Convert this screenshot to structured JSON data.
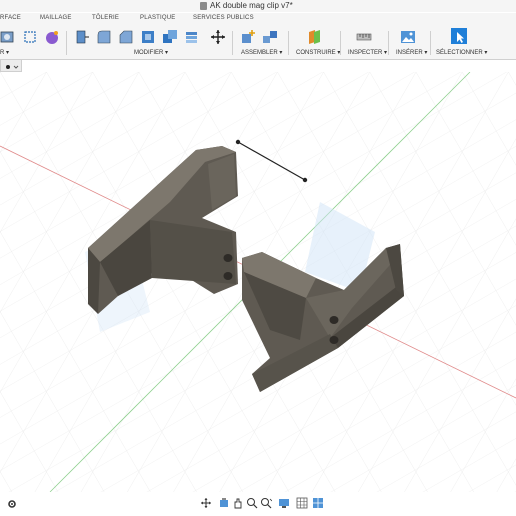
{
  "window": {
    "title": "AK double mag clip v7*"
  },
  "tabs": [
    "RFACE",
    "MAILLAGE",
    "TÔLERIE",
    "PLASTIQUE",
    "SERVICES PUBLICS"
  ],
  "toolbar": {
    "groups": [
      {
        "label": "R ▾"
      },
      {
        "label": "MODIFIER ▾"
      },
      {
        "label": "ASSEMBLER ▾"
      },
      {
        "label": "CONSTRUIRE ▾"
      },
      {
        "label": "INSPECTER ▾"
      },
      {
        "label": "INSÉRER ▾"
      },
      {
        "label": "SÉLECTIONNER ▾"
      }
    ]
  },
  "colors": {
    "toolbar_bg": "#f5f5f5",
    "grid": "#e4e4e4",
    "x_axis": "#e07a7a",
    "y_axis": "#7ec87e",
    "model": "#5a5650",
    "accent": "#1f7fd8"
  },
  "icons": {
    "canvas": [
      "model-clip-left",
      "model-clip-right",
      "sketch-line",
      "axis-lines",
      "grid"
    ],
    "navbar": [
      "orbit-icon",
      "look-at-icon",
      "pan-icon",
      "zoom-icon",
      "fit-icon",
      "display-icon",
      "grid-icon",
      "viewports-icon"
    ]
  }
}
